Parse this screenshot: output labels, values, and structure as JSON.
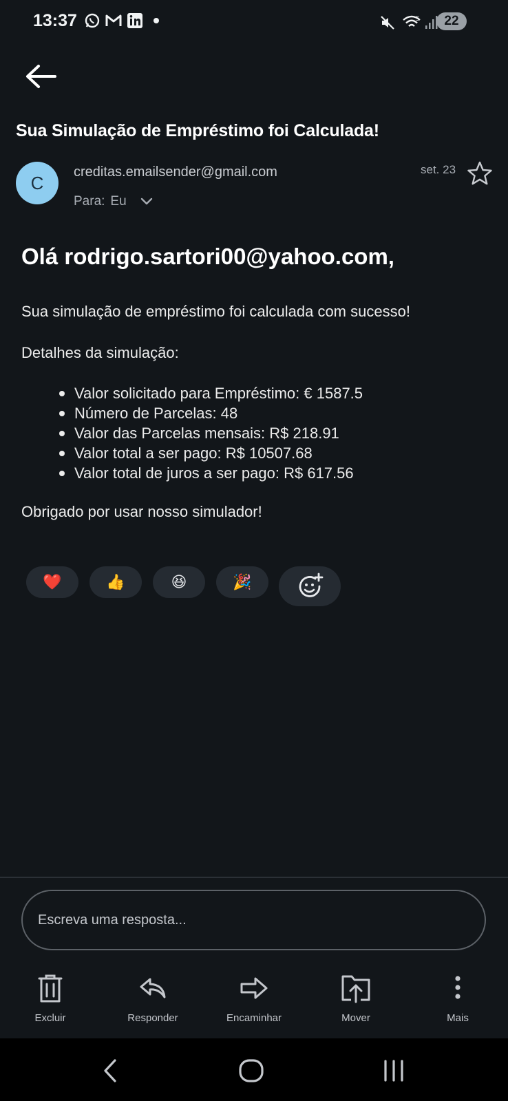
{
  "status_bar": {
    "time": "13:37",
    "battery": "22",
    "left_icons": [
      "whatsapp-icon",
      "gmail-icon",
      "linkedin-icon",
      "dot-icon"
    ],
    "right_icons": [
      "mute-icon",
      "wifi-icon",
      "signal-icon",
      "battery-icon"
    ]
  },
  "email": {
    "subject": "Sua Simulação de Empréstimo foi Calculada!",
    "avatar_letter": "C",
    "sender": "creditas.emailsender@gmail.com",
    "recipient_label": "Para:",
    "recipient": "Eu",
    "date": "set. 23",
    "greeting": "Olá rodrigo.sartori00@yahoo.com,",
    "intro": "Sua simulação de empréstimo foi calculada com sucesso!",
    "details_label": "Detalhes da simulação:",
    "details": [
      "Valor solicitado para Empréstimo: € 1587.5",
      "Número de Parcelas: 48",
      "Valor das Parcelas mensais: R$ 218.91",
      "Valor total a ser pago: R$ 10507.68",
      "Valor total de juros a ser pago: R$ 617.56"
    ],
    "thanks": "Obrigado por usar nosso simulador!"
  },
  "reactions": [
    "❤️",
    "👍",
    "😆",
    "🎉"
  ],
  "reply": {
    "placeholder": "Escreva uma resposta..."
  },
  "actions": {
    "delete": "Excluir",
    "reply": "Responder",
    "forward": "Encaminhar",
    "move": "Mover",
    "more": "Mais"
  },
  "colors": {
    "background": "#12161a",
    "avatar": "#8ecdf0",
    "chip": "#252b32",
    "nav_bar": "#000000"
  }
}
